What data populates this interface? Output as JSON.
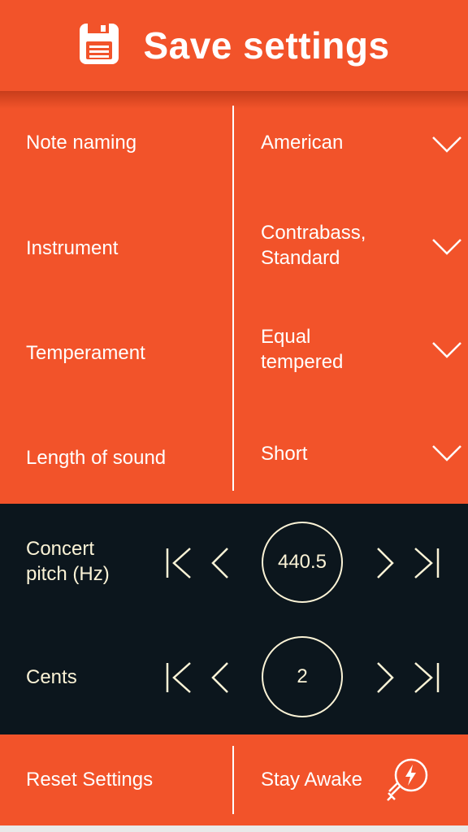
{
  "header": {
    "title": "Save settings",
    "icon": "floppy-disk-icon"
  },
  "settings": [
    {
      "label": "Note naming",
      "value": "American"
    },
    {
      "label": "Instrument",
      "value_line1": "Contrabass,",
      "value_line2": "Standard"
    },
    {
      "label": "Temperament",
      "value_line1": "Equal",
      "value_line2": "tempered"
    },
    {
      "label": "Length of sound",
      "value": "Short"
    }
  ],
  "concert_pitch": {
    "label_line1": "Concert",
    "label_line2": "pitch (Hz)",
    "value": "440.5"
  },
  "cents": {
    "label": "Cents",
    "value": "2"
  },
  "footer": {
    "reset_label": "Reset Settings",
    "awake_label": "Stay Awake",
    "awake_icon": "lightbulb-bolt-icon"
  },
  "colors": {
    "accent": "#f2532a",
    "dark": "#0c161d",
    "cream": "#fbf3d6"
  }
}
